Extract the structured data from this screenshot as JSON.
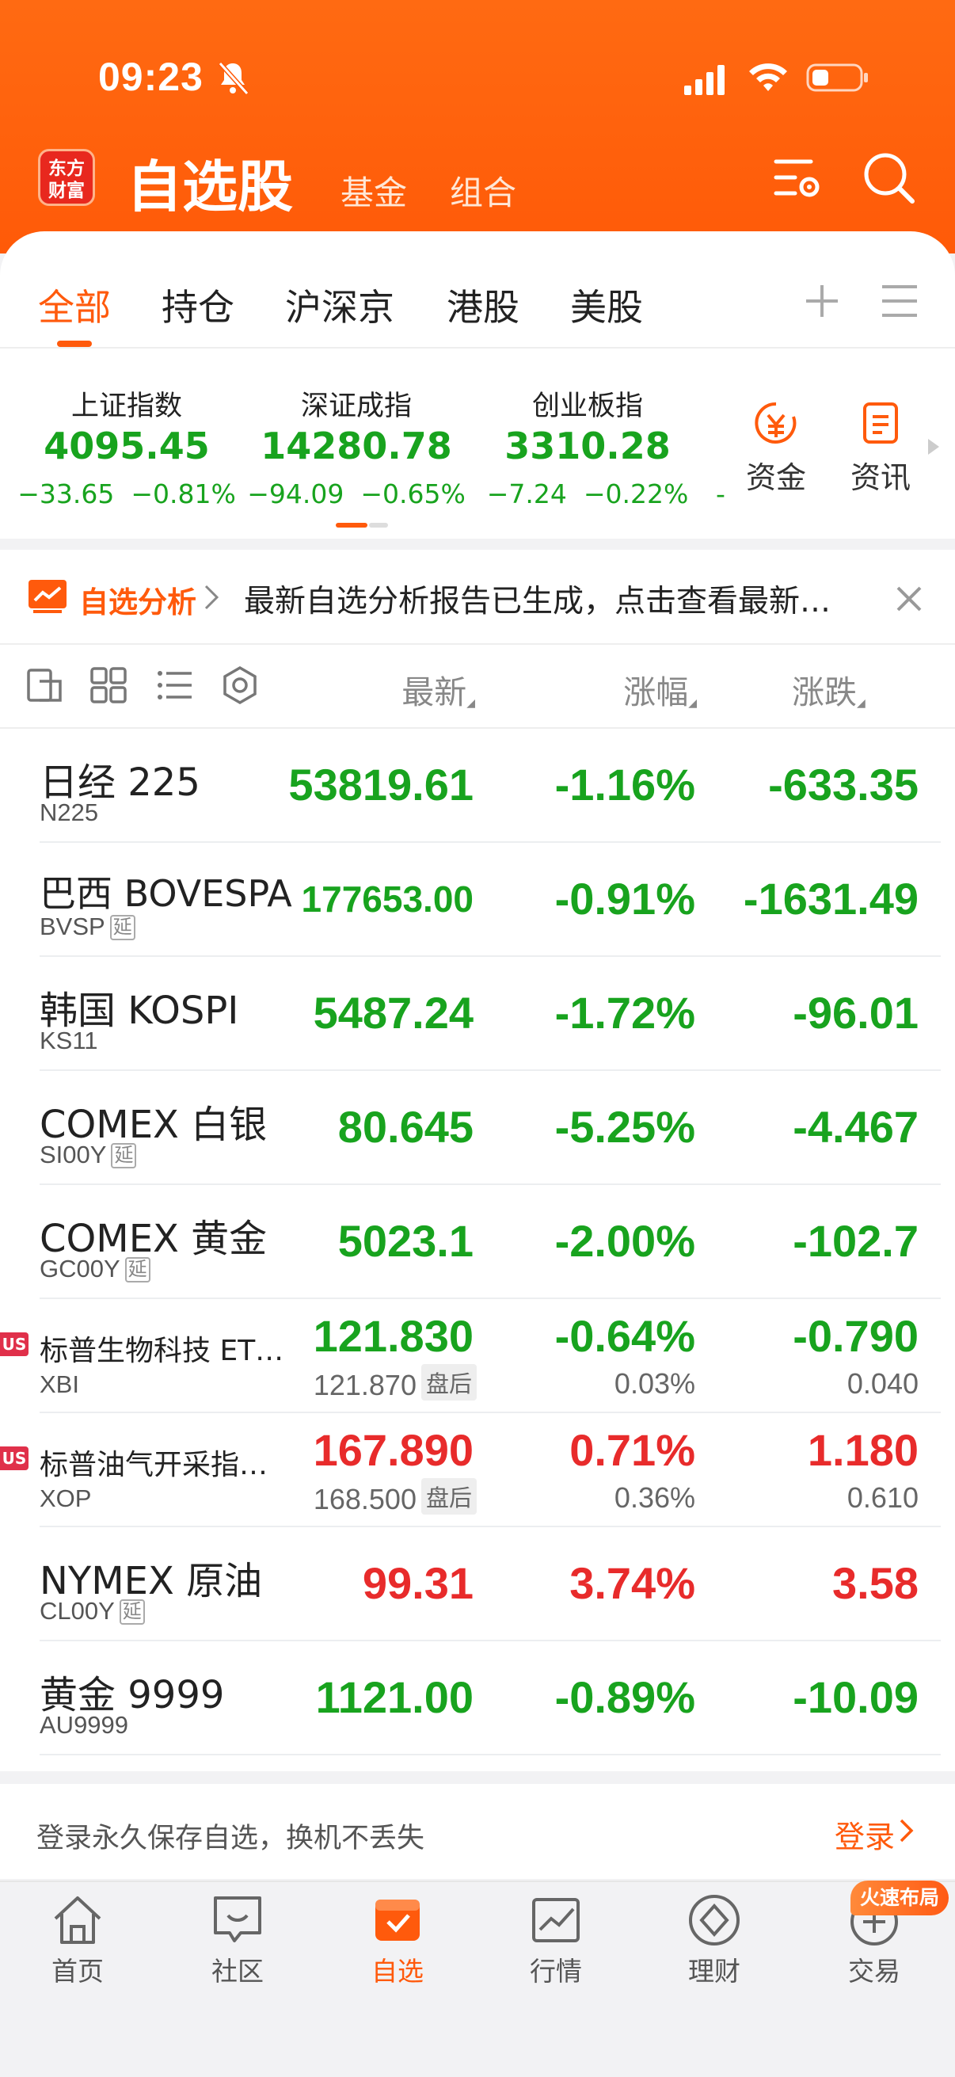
{
  "status": {
    "time": "09:23"
  },
  "header": {
    "logo": "东方财富",
    "logo_line1": "东方",
    "logo_line2": "财富",
    "title": "自选股",
    "subtabs": [
      "基金",
      "组合"
    ]
  },
  "tabs": [
    "全部",
    "持仓",
    "沪深京",
    "港股",
    "美股"
  ],
  "indices": [
    {
      "name": "上证指数",
      "value": "4095.45",
      "change": "−33.65",
      "pct": "−0.81%"
    },
    {
      "name": "深证成指",
      "value": "14280.78",
      "change": "−94.09",
      "pct": "−0.65%"
    },
    {
      "name": "创业板指",
      "value": "3310.28",
      "change": "−7.24",
      "pct": "−0.22%"
    }
  ],
  "index_overflow": "-",
  "shortcuts": [
    {
      "label": "资金",
      "icon": "yuan-icon"
    },
    {
      "label": "资讯",
      "icon": "news-icon"
    }
  ],
  "banner": {
    "tag": "自选分析",
    "text": "最新自选分析报告已生成，点击查看最新…"
  },
  "columns": {
    "latest": "最新",
    "pct": "涨幅",
    "chg": "涨跌"
  },
  "rows": [
    {
      "name": "日经 225",
      "code": "N225",
      "delay": "",
      "latest": "53819.61",
      "pct": "-1.16%",
      "chg": "-633.35",
      "color": "g"
    },
    {
      "name": "巴西 BOVESPA",
      "code": "BVSP",
      "delay": "延",
      "latest": "177653.00",
      "pct": "-0.91%",
      "chg": "-1631.49",
      "color": "g"
    },
    {
      "name": "韩国 KOSPI",
      "code": "KS11",
      "delay": "",
      "latest": "5487.24",
      "pct": "-1.72%",
      "chg": "-96.01",
      "color": "g"
    },
    {
      "name": "COMEX 白银",
      "code": "SI00Y",
      "delay": "延",
      "latest": "80.645",
      "pct": "-5.25%",
      "chg": "-4.467",
      "color": "g"
    },
    {
      "name": "COMEX 黄金",
      "code": "GC00Y",
      "delay": "延",
      "latest": "5023.1",
      "pct": "-2.00%",
      "chg": "-102.7",
      "color": "g"
    },
    {
      "name": "标普生物科技 ET…",
      "code": "XBI",
      "market": "US",
      "latest": "121.830",
      "pct": "-0.64%",
      "chg": "-0.790",
      "color": "g",
      "after_price": "121.870",
      "after_tag": "盘后",
      "after_pct": "0.03%",
      "after_chg": "0.040"
    },
    {
      "name": "标普油气开采指…",
      "code": "XOP",
      "market": "US",
      "latest": "167.890",
      "pct": "0.71%",
      "chg": "1.180",
      "color": "r",
      "after_price": "168.500",
      "after_tag": "盘后",
      "after_pct": "0.36%",
      "after_chg": "0.610"
    },
    {
      "name": "NYMEX 原油",
      "code": "CL00Y",
      "delay": "延",
      "latest": "99.31",
      "pct": "3.74%",
      "chg": "3.58",
      "color": "r"
    },
    {
      "name": "黄金 9999",
      "code": "AU9999",
      "delay": "",
      "latest": "1121.00",
      "pct": "-0.89%",
      "chg": "-10.09",
      "color": "g"
    }
  ],
  "login": {
    "text": "登录永久保存自选，换机不丢失",
    "button": "登录"
  },
  "nav": [
    {
      "label": "首页",
      "icon": "home-icon"
    },
    {
      "label": "社区",
      "icon": "chat-icon"
    },
    {
      "label": "自选",
      "icon": "watchlist-icon"
    },
    {
      "label": "行情",
      "icon": "chart-icon"
    },
    {
      "label": "理财",
      "icon": "diamond-icon"
    },
    {
      "label": "交易",
      "icon": "trade-icon"
    }
  ],
  "nav_badge": "火速布局",
  "colors": {
    "brand": "#ff5a0c",
    "up": "#e82b2b",
    "down": "#18a31e"
  }
}
